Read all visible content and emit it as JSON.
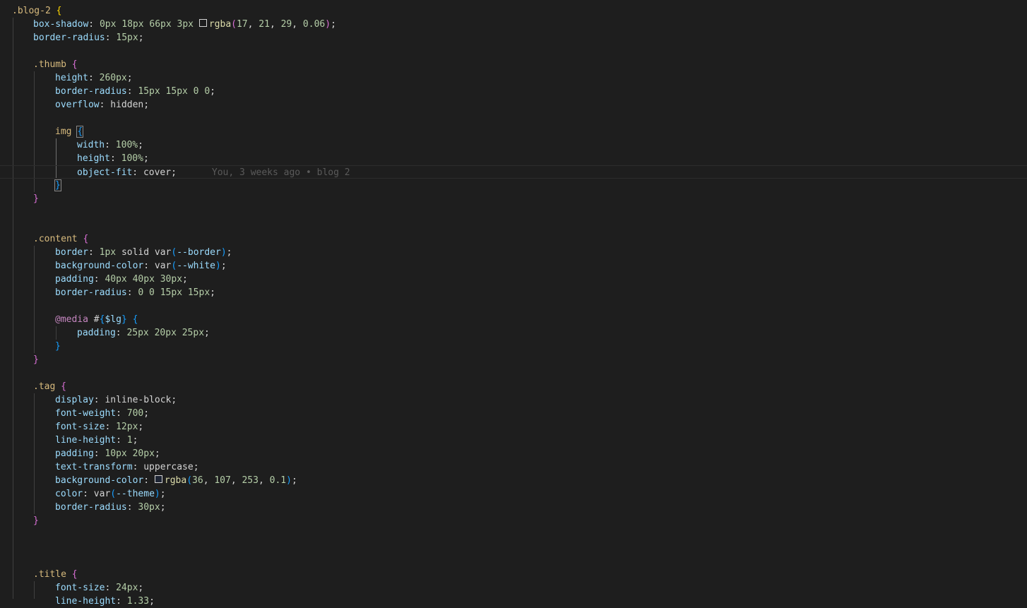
{
  "editor": {
    "blame": "You, 3 weeks ago • blog 2",
    "colors": {
      "background": "#1e1e1e",
      "selector": "#d7ba7d",
      "property": "#9cdcfe",
      "number": "#b5cea8",
      "bracket_level_1": "#ffd700",
      "bracket_level_2": "#da70d6",
      "bracket_level_3": "#179fff"
    }
  },
  "code": {
    "blog2_sel": ".blog-2",
    "l2_prop": "box-shadow",
    "l2_n1": "0px",
    "l2_n2": "18px",
    "l2_n3": "66px",
    "l2_n4": "3px",
    "l2_fn": "rgba",
    "l2_a": "17",
    "l2_b": "21",
    "l2_c": "29",
    "l2_d": "0.06",
    "l3_prop": "border-radius",
    "l3_val": "15px",
    "thumb_sel": ".thumb",
    "l6_prop": "height",
    "l6_val": "260px",
    "l7_prop": "border-radius",
    "l7_val": "15px 15px 0 0",
    "l8_prop": "overflow",
    "l8_val": "hidden",
    "img_sel": "img",
    "l11_prop": "width",
    "l11_val": "100%",
    "l12_prop": "height",
    "l12_val": "100%",
    "l13_prop": "object-fit",
    "l13_val": "cover",
    "content_sel": ".content",
    "l19_prop": "border",
    "l19_n": "1px",
    "l19_w": "solid",
    "l19_fn": "var",
    "l19_v": "--border",
    "l20_prop": "background-color",
    "l20_fn": "var",
    "l20_v": "--white",
    "l21_prop": "padding",
    "l21_val": "40px 40px 30px",
    "l22_prop": "border-radius",
    "l22_val": "0 0 15px 15px",
    "media_kw": "@media",
    "media_hash": "#",
    "media_var": "$lg",
    "l25_prop": "padding",
    "l25_val": "25px 20px 25px",
    "tag_sel": ".tag",
    "l30_prop": "display",
    "l30_val": "inline-block",
    "l31_prop": "font-weight",
    "l31_val": "700",
    "l32_prop": "font-size",
    "l32_val": "12px",
    "l33_prop": "line-height",
    "l33_val": "1",
    "l34_prop": "padding",
    "l34_val": "10px 20px",
    "l35_prop": "text-transform",
    "l35_val": "uppercase",
    "l36_prop": "background-color",
    "l36_fn": "rgba",
    "l36_a": "36",
    "l36_b": "107",
    "l36_c": "253",
    "l36_d": "0.1",
    "l37_prop": "color",
    "l37_fn": "var",
    "l37_v": "--theme",
    "l38_prop": "border-radius",
    "l38_val": "30px",
    "title_sel": ".title",
    "l44_prop": "font-size",
    "l44_val": "24px",
    "l45_prop": "line-height",
    "l45_val": "1.33"
  }
}
